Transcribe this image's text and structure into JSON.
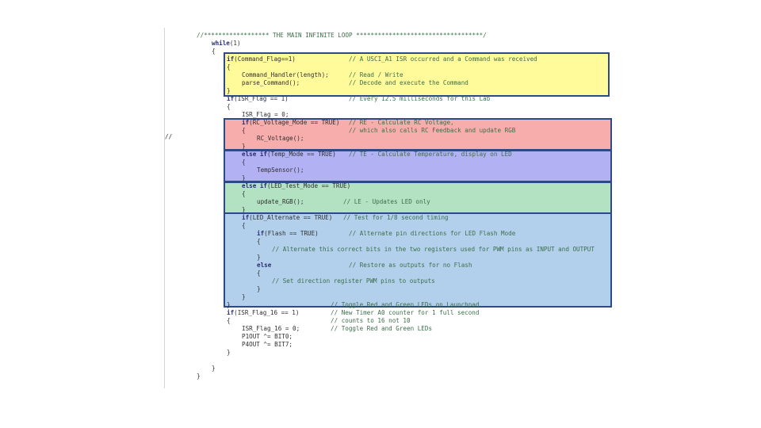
{
  "code_lines": [
    {
      "indent": 0,
      "code": "//****************** THE MAIN INFINITE LOOP ***********************************/",
      "comment": ""
    },
    {
      "indent": 1,
      "code": "while(1)",
      "comment": ""
    },
    {
      "indent": 1,
      "code": "{",
      "comment": ""
    },
    {
      "indent": 2,
      "code": "if(Command_Flag==1)",
      "comment": "// A USCI_A1 ISR occurred and a Command was received"
    },
    {
      "indent": 2,
      "code": "{",
      "comment": ""
    },
    {
      "indent": 3,
      "code": "Command_Handler(length);",
      "comment": "// Read / Write"
    },
    {
      "indent": 3,
      "code": "parse_Command();",
      "comment": "// Decode and execute the Command"
    },
    {
      "indent": 2,
      "code": "}",
      "comment": ""
    },
    {
      "indent": 2,
      "code": "if(ISR_Flag == 1)",
      "comment": "// Every 12.5 milliseconds for this Lab"
    },
    {
      "indent": 2,
      "code": "{",
      "comment": ""
    },
    {
      "indent": 3,
      "code": "ISR_Flag = 0;",
      "comment": ""
    },
    {
      "indent": 3,
      "code": "if(RC_Voltage_Mode == TRUE)",
      "comment": "// RE - Calculate RC Voltage,"
    },
    {
      "indent": 3,
      "code": "{",
      "comment": "// which also calls RC Feedback and update RGB"
    },
    {
      "indent": 4,
      "code": "RC_Voltage();",
      "comment": ""
    },
    {
      "indent": 3,
      "code": "}",
      "comment": ""
    },
    {
      "indent": 3,
      "code": "else if(Temp_Mode == TRUE)",
      "comment": "// TE - Calculate Temperature, display on LED"
    },
    {
      "indent": 3,
      "code": "{",
      "comment": ""
    },
    {
      "indent": 4,
      "code": "TempSensor();",
      "comment": ""
    },
    {
      "indent": 3,
      "code": "}",
      "comment": ""
    },
    {
      "indent": 3,
      "code": "else if(LED_Test_Mode == TRUE)",
      "comment": ""
    },
    {
      "indent": 3,
      "code": "{",
      "comment": ""
    },
    {
      "indent": 4,
      "code": "update_RGB();",
      "comment": "// LE - Updates LED only"
    },
    {
      "indent": 3,
      "code": "}",
      "comment": ""
    },
    {
      "indent": 3,
      "code": "if(LED_Alternate == TRUE)",
      "comment": "// Test for 1/8 second timing"
    },
    {
      "indent": 3,
      "code": "{",
      "comment": ""
    },
    {
      "indent": 4,
      "code": "if(Flash == TRUE)",
      "comment": "// Alternate pin directions for LED Flash Mode"
    },
    {
      "indent": 4,
      "code": "{",
      "comment": ""
    },
    {
      "indent": 5,
      "code": "// Alternate this correct bits in the two registers used for PWM pins as INPUT and OUTPUT",
      "comment": ""
    },
    {
      "indent": 4,
      "code": "}",
      "comment": ""
    },
    {
      "indent": 4,
      "code": "else",
      "comment": "// Restore as outputs for no Flash"
    },
    {
      "indent": 4,
      "code": "{",
      "comment": ""
    },
    {
      "indent": 5,
      "code": "// Set direction register PWM pins to outputs",
      "comment": ""
    },
    {
      "indent": 4,
      "code": "}",
      "comment": ""
    },
    {
      "indent": 3,
      "code": "}",
      "comment": ""
    },
    {
      "indent": 2,
      "code": "}",
      "comment": "// Toggle Red and Green LEDs on Launchpad"
    },
    {
      "indent": 2,
      "code": "if(ISR_Flag_16 == 1)",
      "comment": "// New Timer A0 counter for 1 full second"
    },
    {
      "indent": 2,
      "code": "{",
      "comment": "// counts to 16 not 10"
    },
    {
      "indent": 3,
      "code": "ISR_Flag_16 = 0;",
      "comment": "// Toggle Red and Green LEDs"
    },
    {
      "indent": 3,
      "code": "P1OUT ^= BIT0;",
      "comment": ""
    },
    {
      "indent": 3,
      "code": "P4OUT ^= BIT7;",
      "comment": ""
    },
    {
      "indent": 2,
      "code": "}",
      "comment": ""
    },
    {
      "indent": 1,
      "code": "",
      "comment": ""
    },
    {
      "indent": 1,
      "code": "}",
      "comment": ""
    },
    {
      "indent": 0,
      "code": "}",
      "comment": ""
    }
  ],
  "margin_marker": "//",
  "highlight_colors": {
    "yellow": "#fffa9a",
    "red": "#f8adad",
    "purple": "#b1b1f4",
    "green": "#b2e2c2",
    "blue": "#b2d0ec",
    "border": "#2d4a86"
  }
}
